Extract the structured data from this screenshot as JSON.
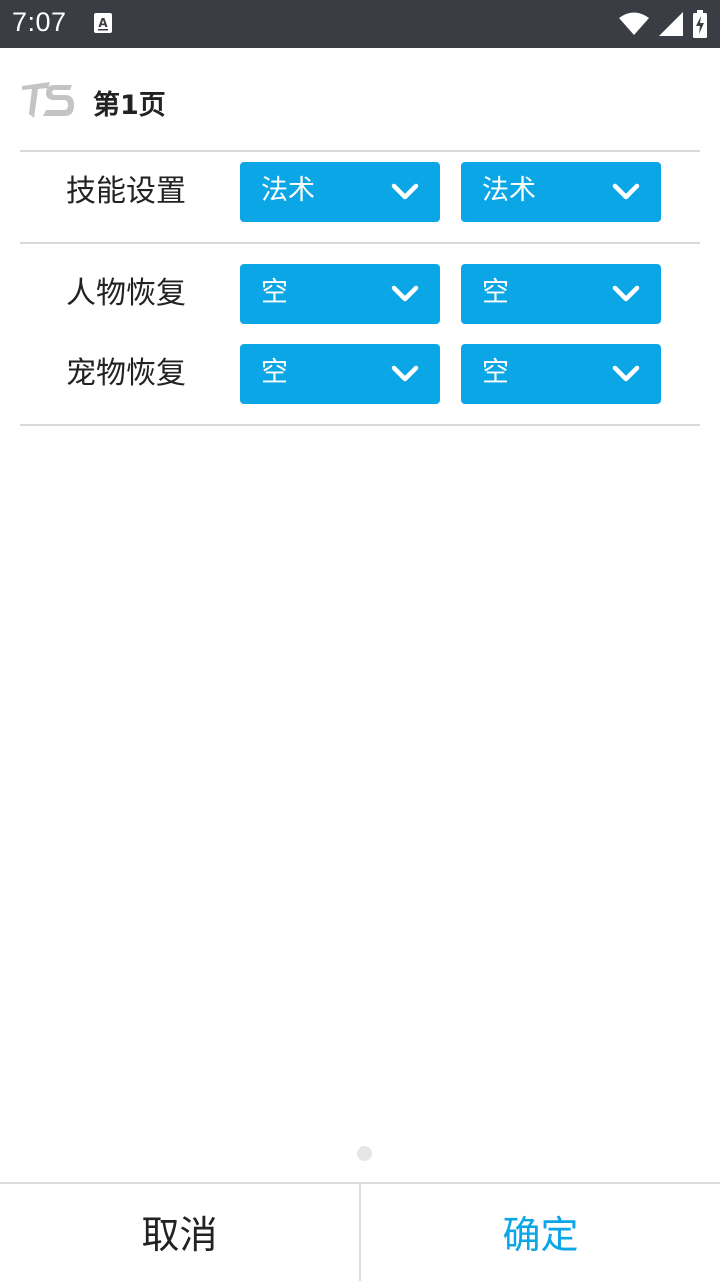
{
  "status_bar": {
    "time": "7:07",
    "icons": [
      "keyboard-a-icon",
      "wifi-icon",
      "signal-icon",
      "battery-charging-icon"
    ]
  },
  "header": {
    "logo_icon": "ts-logo-icon",
    "title": "第1页"
  },
  "sections": {
    "skill": {
      "label": "技能设置",
      "select_1": "法术",
      "select_2": "法术"
    },
    "char_recover": {
      "label": "人物恢复",
      "select_1": "空",
      "select_2": "空"
    },
    "pet_recover": {
      "label": "宠物恢复",
      "select_1": "空",
      "select_2": "空"
    }
  },
  "footer": {
    "cancel_label": "取消",
    "confirm_label": "确定"
  },
  "colors": {
    "accent": "#0aa6e6",
    "status_bar": "#3a3d44",
    "text": "#222222",
    "divider": "#d9d9d9"
  }
}
